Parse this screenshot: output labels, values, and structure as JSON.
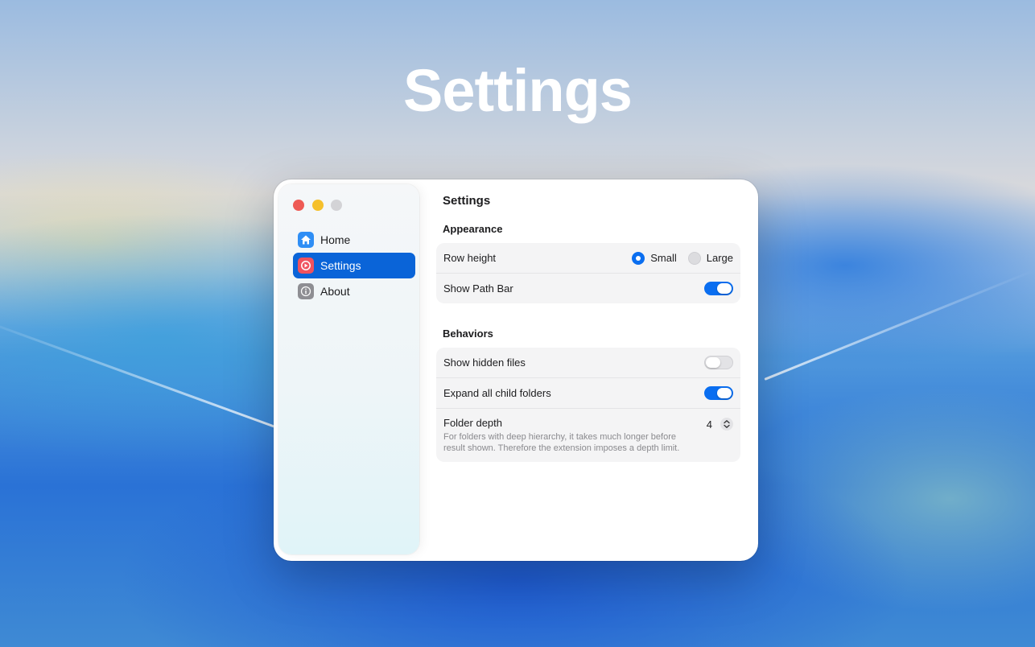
{
  "hero": {
    "title": "Settings"
  },
  "window": {
    "traffic_lights": {
      "close": "#ee5a55",
      "minimize": "#f5c02c",
      "zoom": "#d3d3d6"
    },
    "sidebar": {
      "items": [
        {
          "label": "Home",
          "icon": "house-icon",
          "color": "#2f8ef5",
          "active": false
        },
        {
          "label": "Settings",
          "icon": "gear-icon",
          "color": "#f0525e",
          "active": true
        },
        {
          "label": "About",
          "icon": "info-icon",
          "color": "#8e8e93",
          "active": false
        }
      ]
    },
    "main": {
      "title": "Settings",
      "appearance": {
        "title": "Appearance",
        "row_height": {
          "label": "Row height",
          "options": [
            "Small",
            "Large"
          ],
          "selected": "Small"
        },
        "show_path_bar": {
          "label": "Show Path Bar",
          "enabled": true
        }
      },
      "behaviors": {
        "title": "Behaviors",
        "show_hidden_files": {
          "label": "Show hidden files",
          "enabled": false
        },
        "expand_all": {
          "label": "Expand all child folders",
          "enabled": true
        },
        "folder_depth": {
          "label": "Folder depth",
          "description": "For folders with deep hierarchy, it takes much longer before result shown. Therefore the extension imposes a depth limit.",
          "value": "4"
        }
      }
    },
    "accent_color": "#0a64d8"
  }
}
